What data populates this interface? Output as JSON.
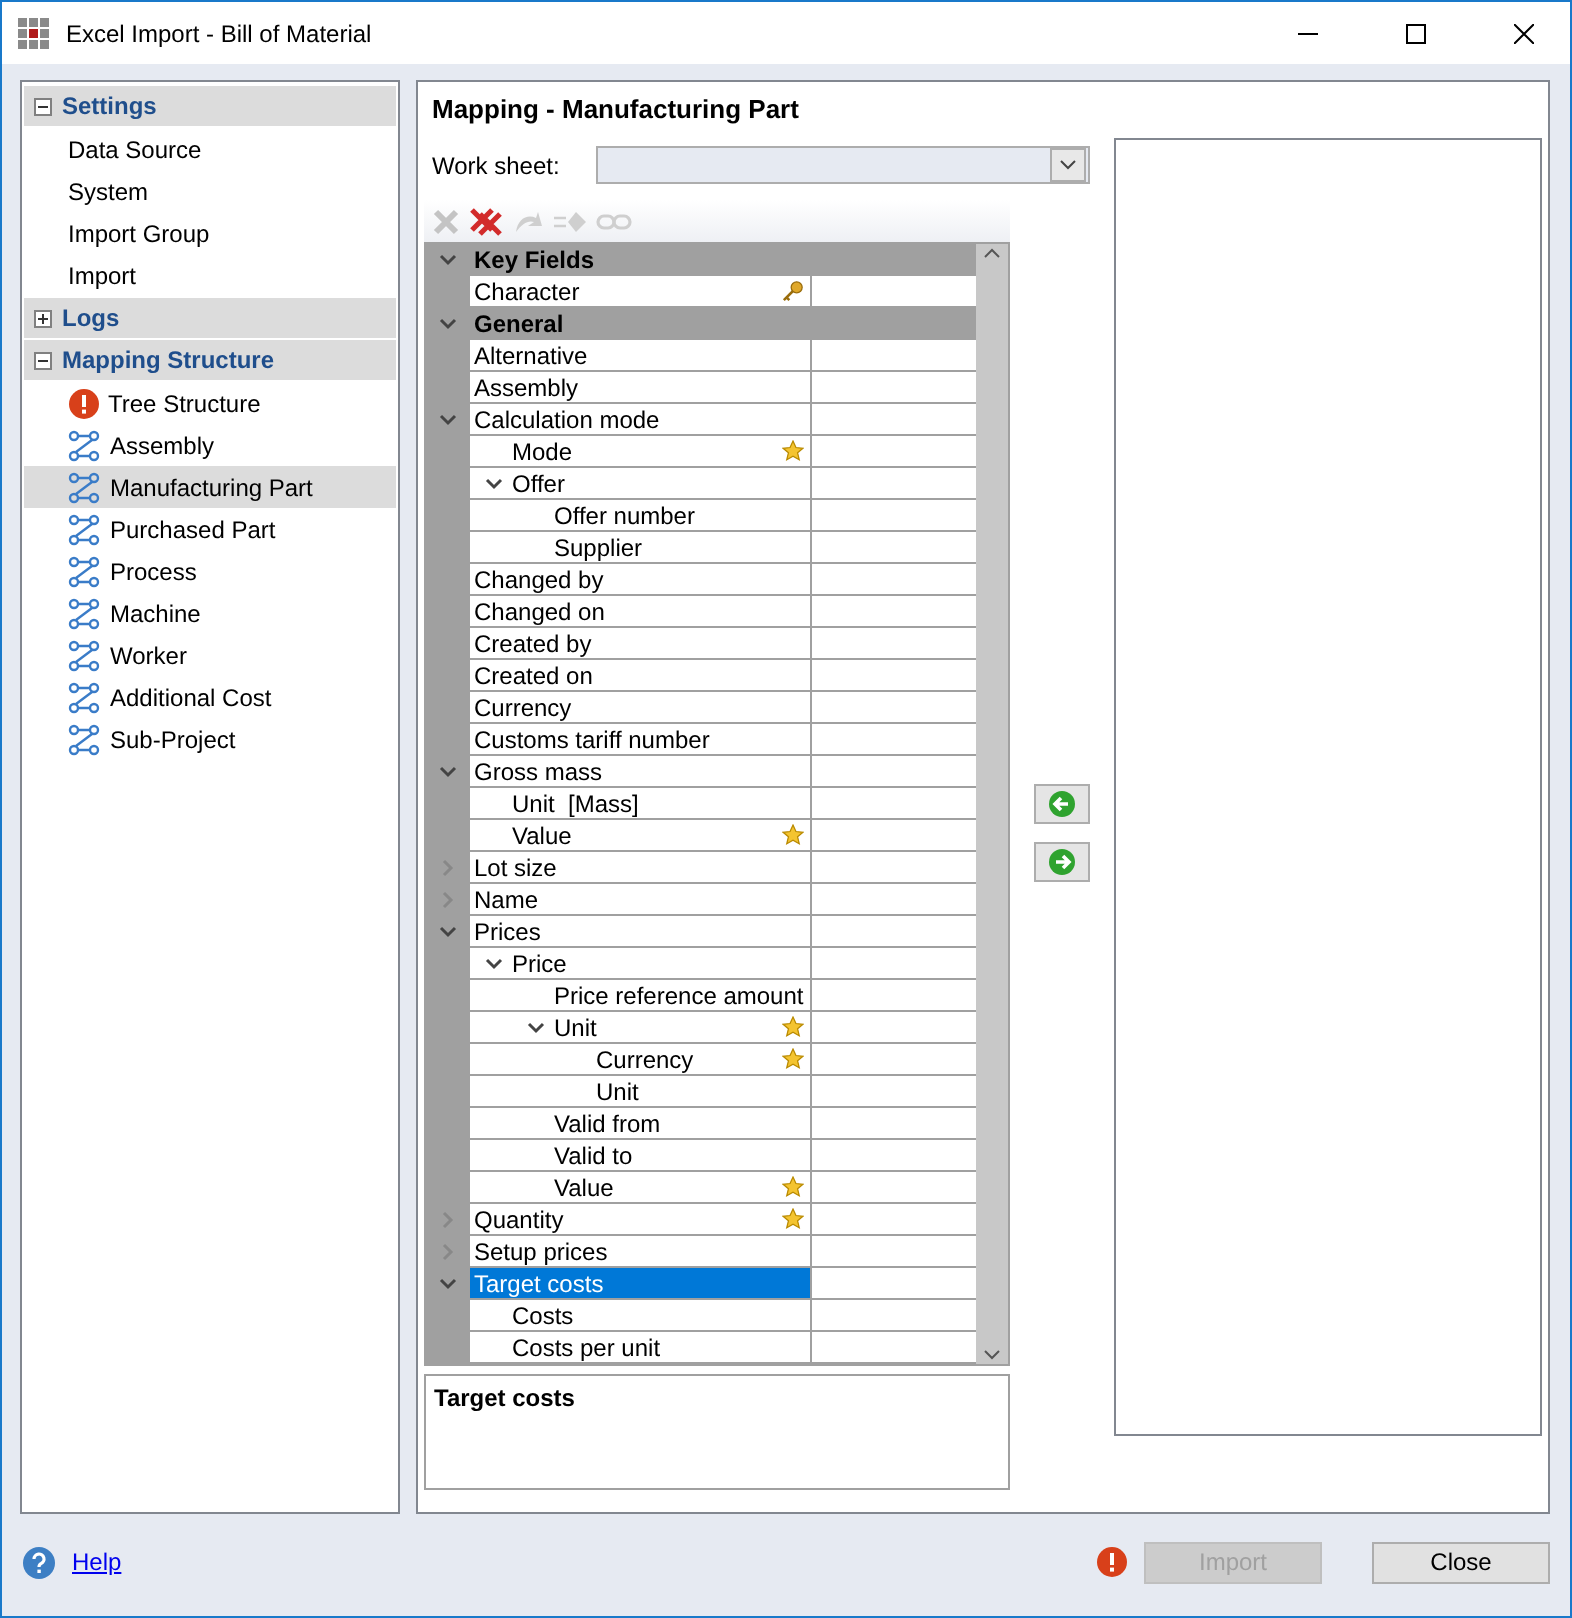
{
  "window": {
    "title": "Excel Import - Bill of Material"
  },
  "sidebar": {
    "sections": [
      {
        "title": "Settings",
        "expanded": true,
        "items": [
          {
            "label": "Data Source",
            "selected": false
          },
          {
            "label": "System",
            "selected": false
          },
          {
            "label": "Import Group",
            "selected": false
          },
          {
            "label": "Import",
            "selected": false
          }
        ]
      },
      {
        "title": "Logs",
        "expanded": false
      },
      {
        "title": "Mapping Structure",
        "expanded": true,
        "items": [
          {
            "label": "Tree Structure",
            "kind": "error",
            "selected": false
          },
          {
            "label": "Assembly",
            "kind": "structure",
            "selected": false
          },
          {
            "label": "Manufacturing Part",
            "kind": "structure",
            "selected": true
          },
          {
            "label": "Purchased Part",
            "kind": "structure",
            "selected": false
          },
          {
            "label": "Process",
            "kind": "structure",
            "selected": false
          },
          {
            "label": "Machine",
            "kind": "structure",
            "selected": false
          },
          {
            "label": "Worker",
            "kind": "structure",
            "selected": false
          },
          {
            "label": "Additional Cost",
            "kind": "structure",
            "selected": false
          },
          {
            "label": "Sub-Project",
            "kind": "structure",
            "selected": false
          }
        ]
      }
    ]
  },
  "mapping": {
    "title": "Mapping - Manufacturing Part",
    "worksheet": {
      "label": "Work sheet:"
    },
    "toolbar": [
      {
        "kind": "remove",
        "disabled": true
      },
      {
        "kind": "remove-all",
        "disabled": false
      },
      {
        "kind": "undo",
        "disabled": true
      },
      {
        "kind": "assign",
        "disabled": true
      },
      {
        "kind": "link",
        "disabled": true
      }
    ],
    "grid": {
      "groups": [
        {
          "title": "Key Fields",
          "expanded": true,
          "rows": [
            {
              "label": "Character",
              "kind": "key",
              "selected": false
            }
          ]
        },
        {
          "title": "General",
          "expanded": true,
          "rows": [
            {
              "label": "Alternative",
              "selected": false
            },
            {
              "label": "Assembly",
              "selected": false
            },
            {
              "label": "Calculation mode",
              "expanded": true,
              "selected": false,
              "children": [
                {
                  "label": "Mode",
                  "kind": "required",
                  "selected": false
                },
                {
                  "label": "Offer",
                  "expanded": true,
                  "selected": false,
                  "children": [
                    {
                      "label": "Offer number",
                      "selected": false
                    },
                    {
                      "label": "Supplier",
                      "selected": false
                    }
                  ]
                }
              ]
            },
            {
              "label": "Changed by",
              "selected": false
            },
            {
              "label": "Changed on",
              "selected": false
            },
            {
              "label": "Created by",
              "selected": false
            },
            {
              "label": "Created on",
              "selected": false
            },
            {
              "label": "Currency",
              "selected": false
            },
            {
              "label": "Customs tariff number",
              "selected": false
            },
            {
              "label": "Gross mass",
              "expanded": true,
              "selected": false,
              "children": [
                {
                  "label": "Unit  [Mass]",
                  "selected": false
                },
                {
                  "label": "Value",
                  "kind": "required",
                  "selected": false
                }
              ]
            },
            {
              "label": "Lot size",
              "expanded": false,
              "selected": false
            },
            {
              "label": "Name",
              "expanded": false,
              "selected": false
            },
            {
              "label": "Prices",
              "expanded": true,
              "selected": false,
              "children": [
                {
                  "label": "Price",
                  "expanded": true,
                  "selected": false,
                  "children": [
                    {
                      "label": "Price reference amount",
                      "selected": false
                    },
                    {
                      "label": "Unit",
                      "expanded": true,
                      "kind": "required",
                      "selected": false,
                      "children": [
                        {
                          "label": "Currency",
                          "kind": "required",
                          "selected": false
                        },
                        {
                          "label": "Unit",
                          "selected": false
                        }
                      ]
                    },
                    {
                      "label": "Valid from",
                      "selected": false
                    },
                    {
                      "label": "Valid to",
                      "selected": false
                    },
                    {
                      "label": "Value",
                      "kind": "required",
                      "selected": false
                    }
                  ]
                }
              ]
            },
            {
              "label": "Quantity",
              "expanded": false,
              "kind": "required",
              "selected": false
            },
            {
              "label": "Setup prices",
              "expanded": false,
              "selected": false
            },
            {
              "label": "Target costs",
              "expanded": true,
              "selected": true,
              "children": [
                {
                  "label": "Costs",
                  "selected": false
                },
                {
                  "label": "Costs per unit",
                  "selected": false
                }
              ]
            }
          ]
        }
      ]
    },
    "description": {
      "title": "Target costs"
    }
  },
  "footer": {
    "help": "Help",
    "warning": true,
    "import": {
      "label": "Import",
      "disabled": true
    },
    "close": {
      "label": "Close",
      "disabled": false
    }
  }
}
